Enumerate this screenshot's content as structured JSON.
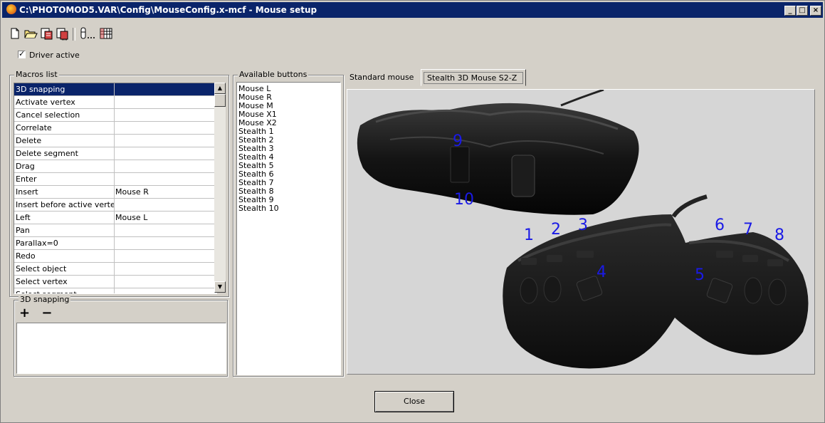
{
  "window": {
    "title": "C:\\PHOTOMOD5.VAR\\Config\\MouseConfig.x-mcf - Mouse setup",
    "controls": [
      "_",
      "□",
      "×"
    ]
  },
  "toolbar": {
    "icons": [
      "new-file-icon",
      "open-folder-icon",
      "save-icon",
      "save-as-icon",
      "mouse-settings-icon",
      "grid-icon"
    ]
  },
  "driver": {
    "label": "Driver active",
    "checked": true,
    "check_mark": "✓"
  },
  "macros": {
    "group_title": "Macros list",
    "rows": [
      {
        "name": "3D snapping",
        "button": ""
      },
      {
        "name": "Activate vertex",
        "button": ""
      },
      {
        "name": "Cancel selection",
        "button": ""
      },
      {
        "name": "Correlate",
        "button": ""
      },
      {
        "name": "Delete",
        "button": ""
      },
      {
        "name": "Delete segment",
        "button": ""
      },
      {
        "name": "Drag",
        "button": ""
      },
      {
        "name": "Enter",
        "button": ""
      },
      {
        "name": "Insert",
        "button": "Mouse R"
      },
      {
        "name": "Insert before active vertex",
        "button": ""
      },
      {
        "name": "Left",
        "button": "Mouse L"
      },
      {
        "name": "Pan",
        "button": ""
      },
      {
        "name": "Parallax=0",
        "button": ""
      },
      {
        "name": "Redo",
        "button": ""
      },
      {
        "name": "Select object",
        "button": ""
      },
      {
        "name": "Select vertex",
        "button": ""
      },
      {
        "name": "Select segment",
        "button": ""
      }
    ],
    "selected_index": 0
  },
  "snapping": {
    "group_title": "3D snapping",
    "add_label": "+",
    "remove_label": "−"
  },
  "available": {
    "group_title": "Available buttons",
    "items": [
      "Mouse L",
      "Mouse R",
      "Mouse M",
      "Mouse X1",
      "Mouse X2",
      "Stealth 1",
      "Stealth 2",
      "Stealth 3",
      "Stealth 4",
      "Stealth 5",
      "Stealth 6",
      "Stealth 7",
      "Stealth 8",
      "Stealth 9",
      "Stealth 10"
    ]
  },
  "tabs": [
    {
      "label": "Standard mouse",
      "active": false
    },
    {
      "label": "Stealth 3D Mouse S2-Z",
      "active": true
    }
  ],
  "device_labels": [
    "1",
    "2",
    "3",
    "4",
    "5",
    "6",
    "7",
    "8",
    "9",
    "10"
  ],
  "close_label": "Close",
  "colors": {
    "title_bar": "#0a246a",
    "selection": "#0a246a",
    "button_numbers": "#1a1ae6",
    "face": "#d4d0c8"
  }
}
